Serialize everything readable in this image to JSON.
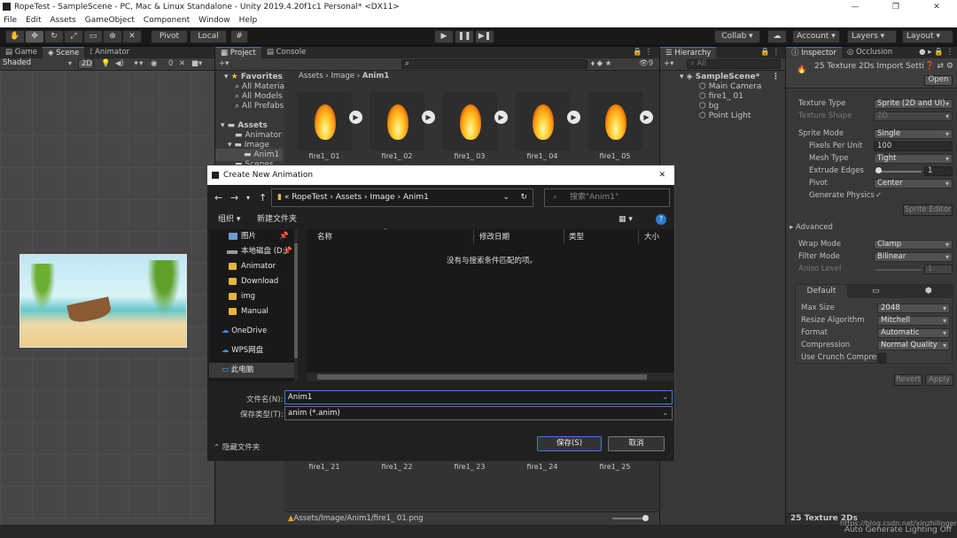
{
  "window": {
    "title": "RopeTest - SampleScene - PC, Mac & Linux Standalone - Unity 2019.4.20f1c1 Personal* <DX11>"
  },
  "menu": [
    "File",
    "Edit",
    "Assets",
    "GameObject",
    "Component",
    "Window",
    "Help"
  ],
  "toolbar": {
    "pivot": "Pivot",
    "local": "Local",
    "collab": "Collab",
    "account": "Account",
    "layers": "Layers",
    "layout": "Layout"
  },
  "game": {
    "tabs": [
      "Game",
      "Scene",
      "Animator"
    ],
    "shaded": "Shaded",
    "mode2d": "2D",
    "gizmo_count": "0"
  },
  "project": {
    "tabs": [
      "Project",
      "Console"
    ],
    "favorites": "Favorites",
    "fav_items": [
      "All Materia",
      "All Models",
      "All Prefabs"
    ],
    "assets": "Assets",
    "tree": [
      "Animator",
      "Image",
      "Anim1",
      "Scenes"
    ],
    "breadcrumb": [
      "Assets",
      "Image",
      "Anim1"
    ],
    "count": "9",
    "sprites_top": [
      "fire1_ 01",
      "fire1_ 02",
      "fire1_ 03",
      "fire1_ 04",
      "fire1_ 05"
    ],
    "sprites_bottom": [
      "fire1_ 21",
      "fire1_ 22",
      "fire1_ 23",
      "fire1_ 24",
      "fire1_ 25"
    ],
    "status_path": "Assets/Image/Anim1/fire1_ 01.png"
  },
  "hierarchy": {
    "tab": "Hierarchy",
    "search": "All",
    "scene": "SampleScene*",
    "items": [
      "Main Camera",
      "fire1_ 01",
      "bg",
      "Point Light"
    ]
  },
  "inspector": {
    "tabs": [
      "Inspector",
      "Occlusion"
    ],
    "title": "25 Texture 2Ds Import Setti",
    "open": "Open",
    "rows": [
      {
        "label": "Texture Type",
        "value": "Sprite (2D and UI)"
      },
      {
        "label": "Texture Shape",
        "value": "2D"
      },
      {
        "label": "Sprite Mode",
        "value": "Single"
      },
      {
        "label": "Pixels Per Unit",
        "value": "100"
      },
      {
        "label": "Mesh Type",
        "value": "Tight"
      },
      {
        "label": "Extrude Edges",
        "value": "1"
      },
      {
        "label": "Pivot",
        "value": "Center"
      },
      {
        "label": "Generate Physics",
        "value": "✓"
      }
    ],
    "sprite_editor": "Sprite Editor",
    "advanced": "Advanced",
    "rows2": [
      {
        "label": "Wrap Mode",
        "value": "Clamp"
      },
      {
        "label": "Filter Mode",
        "value": "Bilinear"
      },
      {
        "label": "Aniso Level",
        "value": "1"
      }
    ],
    "platform_default": "Default",
    "rows3": [
      {
        "label": "Max Size",
        "value": "2048"
      },
      {
        "label": "Resize Algorithm",
        "value": "Mitchell"
      },
      {
        "label": "Format",
        "value": "Automatic"
      },
      {
        "label": "Compression",
        "value": "Normal Quality"
      },
      {
        "label": "Use Crunch Compres",
        "value": ""
      }
    ],
    "revert": "Revert",
    "apply": "Apply",
    "footer": "25 Texture 2Ds"
  },
  "status": {
    "right": "Auto Generate Lighting Off",
    "watermark": "https://blog.csdn.net/xinzhilinger"
  },
  "dialog": {
    "title": "Create New Animation",
    "path": [
      "RopeTest",
      "Assets",
      "Image",
      "Anim1"
    ],
    "search_placeholder": "搜索\"Anim1\"",
    "organize": "组织 ▾",
    "new_folder": "新建文件夹",
    "side": [
      {
        "label": "图片",
        "type": "pic"
      },
      {
        "label": "本地磁盘 (D:)",
        "type": "disk"
      },
      {
        "label": "Animator",
        "type": "folder"
      },
      {
        "label": "Download",
        "type": "folder"
      },
      {
        "label": "img",
        "type": "folder"
      },
      {
        "label": "Manual",
        "type": "folder"
      },
      {
        "label": "OneDrive",
        "type": "cloud"
      },
      {
        "label": "WPS网盘",
        "type": "cloud"
      },
      {
        "label": "此电脑",
        "type": "pc"
      }
    ],
    "columns": [
      "名称",
      "修改日期",
      "类型",
      "大小"
    ],
    "empty": "没有与搜索条件匹配的项。",
    "filename_label": "文件名(N):",
    "filename": "Anim1",
    "filetype_label": "保存类型(T):",
    "filetype": "anim (*.anim)",
    "hide_folders": "隐藏文件夹",
    "save": "保存(S)",
    "cancel": "取消"
  }
}
